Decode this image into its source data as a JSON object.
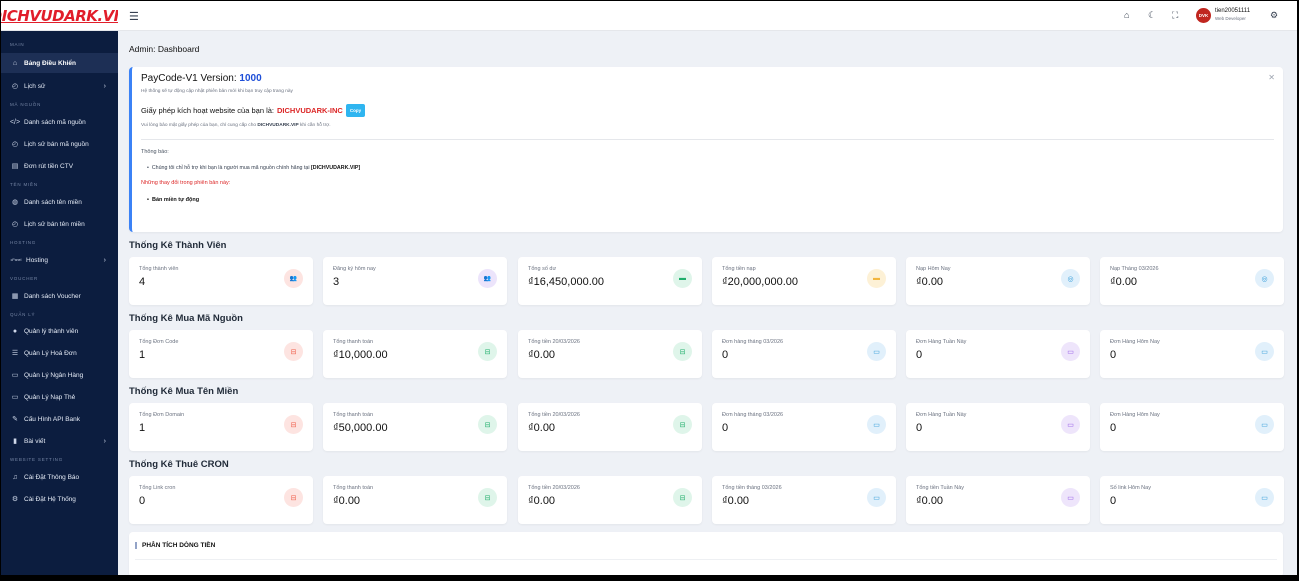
{
  "brand": {
    "logo_text": "DICHVUDARK.VIP"
  },
  "sidebar": {
    "sections": [
      "MAIN",
      "MÃ NGUỒN",
      "TÊN MIỀN",
      "HOSTING",
      "VOUCHER",
      "QUẢN LÝ",
      "WEBSITE SETTING"
    ],
    "items": [
      {
        "label": "Bảng Điều Khiển",
        "icon": "home-icon",
        "active": true
      },
      {
        "label": "Lịch sử",
        "icon": "history-icon",
        "has_children": true
      },
      {
        "label": "Danh sách mã nguồn",
        "icon": "code-icon"
      },
      {
        "label": "Lịch sử bán mã nguồn",
        "icon": "history-icon"
      },
      {
        "label": "Đơn rút tiền CTV",
        "icon": "wallet-icon"
      },
      {
        "label": "Danh sách tên miền",
        "icon": "globe-icon"
      },
      {
        "label": "Lịch sử bán tên miền",
        "icon": "history-icon"
      },
      {
        "label": "Hosting",
        "icon": "cpanel-icon",
        "icon_text": "cPanel",
        "has_children": true
      },
      {
        "label": "Danh sách Voucher",
        "icon": "ticket-icon"
      },
      {
        "label": "Quản lý thành viên",
        "icon": "user-icon"
      },
      {
        "label": "Quản Lý Hoá Đơn",
        "icon": "database-icon"
      },
      {
        "label": "Quản Lý Ngân Hàng",
        "icon": "card-icon"
      },
      {
        "label": "Quản Lý Nạp Thẻ",
        "icon": "card-icon"
      },
      {
        "label": "Cấu Hình API Bank",
        "icon": "wrench-icon"
      },
      {
        "label": "Bài viết",
        "icon": "book-icon",
        "has_children": true
      },
      {
        "label": "Cài Đặt Thông Báo",
        "icon": "bell-icon"
      },
      {
        "label": "Cài Đặt Hệ Thống",
        "icon": "gear-icon"
      }
    ]
  },
  "topbar": {
    "user_name": "tien20051111",
    "user_role": "Web Developer",
    "avatar_text": "DVK",
    "icons": [
      "menu-icon",
      "home-icon",
      "moon-icon",
      "fullscreen-icon",
      "gear-icon"
    ]
  },
  "page": {
    "title": "Admin: Dashboard"
  },
  "notice": {
    "title_prefix": "PayCode-V1 Version:",
    "version": "1000",
    "subtitle": "Hệ thống sẽ tự động cập nhật phiên bản mới khi bạn truy cập trang này",
    "license_prefix": "Giấy phép kích hoạt website của bạn là:",
    "license_name": "DICHVUDARK-INC",
    "copy_label": "Copy",
    "help_prefix": "Vui lòng bảo mật giấy phép của bạn, chỉ cung cấp cho",
    "help_bold": "DICHVUDARK.VIP",
    "help_suffix": "khi cần hỗ trợ.",
    "announce_label": "Thông báo:",
    "announce_text": "Chúng tôi chỉ hỗ trợ khi bạn là người mua mã nguồn chính hãng tại",
    "announce_bold": "[DICHVUDARK.VIP]",
    "changes_label": "Những thay đổi trong phiên bản này:",
    "change_item": "Bán miền tự động"
  },
  "sections": [
    {
      "title": "Thống Kê Thành Viên",
      "stats": [
        {
          "label": "Tổng thành viên",
          "value": "4",
          "icon": "users-icon",
          "color": "#ef5b48"
        },
        {
          "label": "Đăng ký hôm nay",
          "value": "3",
          "icon": "users-icon",
          "color": "#8a5cf6"
        },
        {
          "label": "Tổng số dư",
          "value": "₫16,450,000.00",
          "icon": "wallet-icon",
          "color": "#1fae6b"
        },
        {
          "label": "Tổng tiền nạp",
          "value": "₫20,000,000.00",
          "icon": "wallet-icon",
          "color": "#f2b53d"
        },
        {
          "label": "Nạp Hôm Nay",
          "value": "₫0.00",
          "icon": "coin-icon",
          "color": "#2f9ad8"
        },
        {
          "label": "Nạp Tháng 03/2026",
          "value": "₫0.00",
          "icon": "coin-icon",
          "color": "#2f9ad8"
        }
      ]
    },
    {
      "title": "Thống Kê Mua Mã Nguồn",
      "stats": [
        {
          "label": "Tổng Đơn Code",
          "value": "1",
          "icon": "basket-icon",
          "color": "#ef5b48"
        },
        {
          "label": "Tổng thanh toán",
          "value": "₫10,000.00",
          "icon": "basket-icon",
          "color": "#1fae6b"
        },
        {
          "label": "Tổng tiền 20/03/2026",
          "value": "₫0.00",
          "icon": "basket-icon",
          "color": "#1fae6b"
        },
        {
          "label": "Đơn hàng tháng 03/2026",
          "value": "0",
          "icon": "calendar-icon",
          "color": "#2f9ad8"
        },
        {
          "label": "Đơn Hàng Tuần Này",
          "value": "0",
          "icon": "calendar-icon",
          "color": "#9457e8"
        },
        {
          "label": "Đơn Hàng Hôm Nay",
          "value": "0",
          "icon": "calendar-icon",
          "color": "#2f9ad8"
        }
      ]
    },
    {
      "title": "Thống Kê Mua Tên Miền",
      "stats": [
        {
          "label": "Tổng Đơn Domain",
          "value": "1",
          "icon": "basket-icon",
          "color": "#ef5b48"
        },
        {
          "label": "Tổng thanh toán",
          "value": "₫50,000.00",
          "icon": "basket-icon",
          "color": "#1fae6b"
        },
        {
          "label": "Tổng tiền 20/03/2026",
          "value": "₫0.00",
          "icon": "basket-icon",
          "color": "#1fae6b"
        },
        {
          "label": "Đơn hàng tháng 03/2026",
          "value": "0",
          "icon": "calendar-icon",
          "color": "#2f9ad8"
        },
        {
          "label": "Đơn Hàng Tuần Này",
          "value": "0",
          "icon": "calendar-icon",
          "color": "#9457e8"
        },
        {
          "label": "Đơn Hàng Hôm Nay",
          "value": "0",
          "icon": "calendar-icon",
          "color": "#2f9ad8"
        }
      ]
    },
    {
      "title": "Thống Kê Thuê CRON",
      "stats": [
        {
          "label": "Tổng Link cron",
          "value": "0",
          "icon": "basket-icon",
          "color": "#ef5b48"
        },
        {
          "label": "Tổng thanh toán",
          "value": "₫0.00",
          "icon": "basket-icon",
          "color": "#1fae6b"
        },
        {
          "label": "Tổng tiền 20/03/2026",
          "value": "₫0.00",
          "icon": "basket-icon",
          "color": "#1fae6b"
        },
        {
          "label": "Tổng tiền tháng 03/2026",
          "value": "₫0.00",
          "icon": "calendar-icon",
          "color": "#2f9ad8"
        },
        {
          "label": "Tổng tiền Tuần Này",
          "value": "₫0.00",
          "icon": "calendar-icon",
          "color": "#9457e8"
        },
        {
          "label": "Số link Hôm Nay",
          "value": "0",
          "icon": "calendar-icon",
          "color": "#2f9ad8"
        }
      ]
    }
  ],
  "analysis": {
    "title": "PHÂN TÍCH DÒNG TIỀN"
  }
}
